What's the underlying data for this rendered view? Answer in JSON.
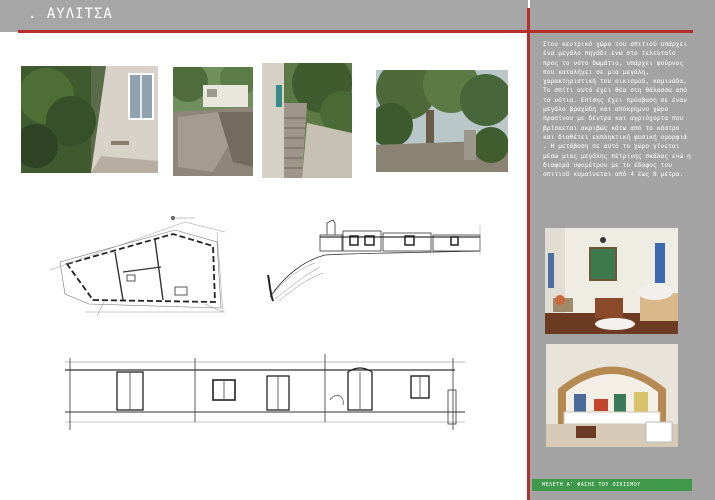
{
  "title": ". ΑΥΛΙΤΣΑ",
  "side_text": "Στον κεντρικό χώρο του σπιτιού υπάρχει ένα μεγάλο πηγάδι ενώ στο τελευταίο προς το νότο δωμάτιο, υπάρχει φούρνος που καταλήγει σε μια μεγάλη, χαρακτηριστική του οικισμού, καμινάδα. Το σπίτι αυτό έχει θέα στη θάλασσα από τα νότια. Επίσης έχει πρόσβαση σε έναν μεγάλο βραχώδη και απόκρημνο χώρο πρασίνου με δέντρα και αγριόχορτα που βρίσκεται ακριβώς κάτω από το κάστρο και διαθέτει εκπληκτική φυσική ομορφιά . Η μετάβαση σε αυτό το χώρο γίνεται μέσω μιας μεγάλης πέτρινης σκάλας ενώ η διαφορά υψομέτρου με το έδαφος του σπιτιού κυμαίνεται από 4 έως 8 μέτρα.",
  "footer": "ΜΕΛΕΤΗ Α' ΦΑΣΗΣ ΤΟΥ ΟΙΚΙΣΜΟΥ",
  "colors": {
    "accent_red": "#b5302d",
    "panel_gray": "#a3a3a3",
    "footer_green": "#3e9a4a"
  }
}
